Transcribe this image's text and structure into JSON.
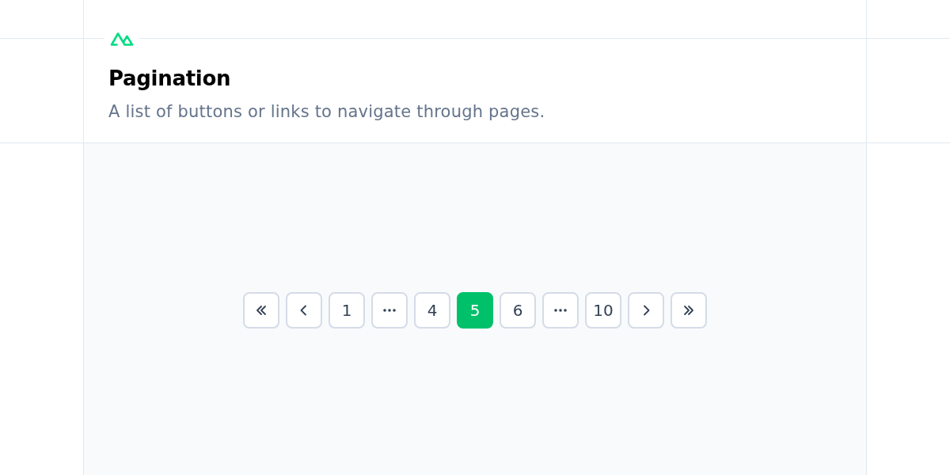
{
  "header": {
    "title": "Pagination",
    "description": "A list of buttons or links to navigate through pages."
  },
  "pagination": {
    "items": [
      {
        "kind": "first"
      },
      {
        "kind": "prev"
      },
      {
        "kind": "page",
        "label": "1",
        "selected": false
      },
      {
        "kind": "ellipsis"
      },
      {
        "kind": "page",
        "label": "4",
        "selected": false
      },
      {
        "kind": "page",
        "label": "5",
        "selected": true
      },
      {
        "kind": "page",
        "label": "6",
        "selected": false
      },
      {
        "kind": "ellipsis"
      },
      {
        "kind": "page",
        "label": "10",
        "selected": false
      },
      {
        "kind": "next"
      },
      {
        "kind": "last"
      }
    ]
  }
}
